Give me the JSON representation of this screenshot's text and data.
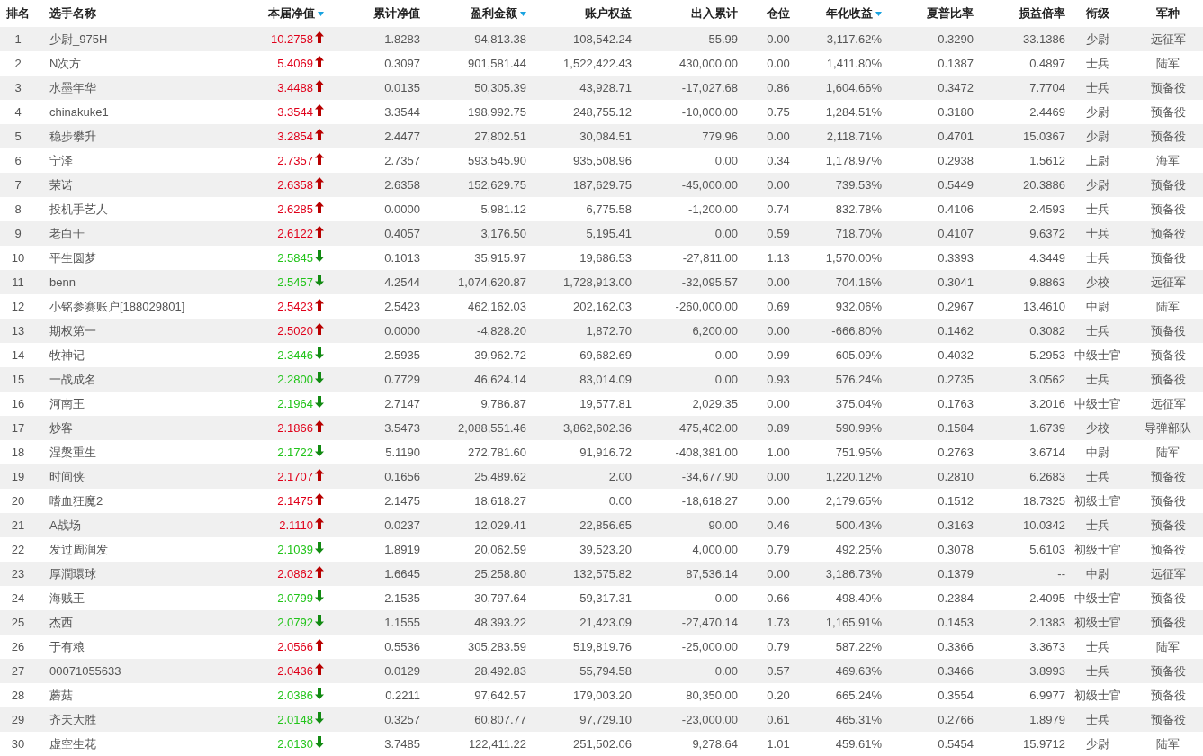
{
  "table": {
    "columns": [
      {
        "label": "排名",
        "sort_indicator": false
      },
      {
        "label": "选手名称",
        "sort_indicator": false
      },
      {
        "label": "本届净值",
        "sort_indicator": true
      },
      {
        "label": "累计净值",
        "sort_indicator": false
      },
      {
        "label": "盈利金额",
        "sort_indicator": true
      },
      {
        "label": "账户权益",
        "sort_indicator": false
      },
      {
        "label": "出入累计",
        "sort_indicator": false
      },
      {
        "label": "仓位",
        "sort_indicator": false
      },
      {
        "label": "年化收益",
        "sort_indicator": true
      },
      {
        "label": "夏普比率",
        "sort_indicator": false
      },
      {
        "label": "损益倍率",
        "sort_indicator": false
      },
      {
        "label": "衔级",
        "sort_indicator": false
      },
      {
        "label": "军种",
        "sort_indicator": false
      }
    ],
    "rows": [
      {
        "rising": true,
        "cells": [
          "1",
          "少尉_975H",
          "10.2758",
          "1.8283",
          "94,813.38",
          "108,542.24",
          "55.99",
          "0.00",
          "3,117.62%",
          "0.3290",
          "33.1386",
          "少尉",
          "远征军"
        ]
      },
      {
        "rising": true,
        "cells": [
          "2",
          "N次方",
          "5.4069",
          "0.3097",
          "901,581.44",
          "1,522,422.43",
          "430,000.00",
          "0.00",
          "1,411.80%",
          "0.1387",
          "0.4897",
          "士兵",
          "陆军"
        ]
      },
      {
        "rising": true,
        "cells": [
          "3",
          "水墨年华",
          "3.4488",
          "0.0135",
          "50,305.39",
          "43,928.71",
          "-17,027.68",
          "0.86",
          "1,604.66%",
          "0.3472",
          "7.7704",
          "士兵",
          "预备役"
        ]
      },
      {
        "rising": true,
        "cells": [
          "4",
          "chinakuke1",
          "3.3544",
          "3.3544",
          "198,992.75",
          "248,755.12",
          "-10,000.00",
          "0.75",
          "1,284.51%",
          "0.3180",
          "2.4469",
          "少尉",
          "预备役"
        ]
      },
      {
        "rising": true,
        "cells": [
          "5",
          "稳步攀升",
          "3.2854",
          "2.4477",
          "27,802.51",
          "30,084.51",
          "779.96",
          "0.00",
          "2,118.71%",
          "0.4701",
          "15.0367",
          "少尉",
          "预备役"
        ]
      },
      {
        "rising": true,
        "cells": [
          "6",
          "宁泽",
          "2.7357",
          "2.7357",
          "593,545.90",
          "935,508.96",
          "0.00",
          "0.34",
          "1,178.97%",
          "0.2938",
          "1.5612",
          "上尉",
          "海军"
        ]
      },
      {
        "rising": true,
        "cells": [
          "7",
          "荣诺",
          "2.6358",
          "2.6358",
          "152,629.75",
          "187,629.75",
          "-45,000.00",
          "0.00",
          "739.53%",
          "0.5449",
          "20.3886",
          "少尉",
          "预备役"
        ]
      },
      {
        "rising": true,
        "cells": [
          "8",
          "投机手艺人",
          "2.6285",
          "0.0000",
          "5,981.12",
          "6,775.58",
          "-1,200.00",
          "0.74",
          "832.78%",
          "0.4106",
          "2.4593",
          "士兵",
          "预备役"
        ]
      },
      {
        "rising": true,
        "cells": [
          "9",
          "老白干",
          "2.6122",
          "0.4057",
          "3,176.50",
          "5,195.41",
          "0.00",
          "0.59",
          "718.70%",
          "0.4107",
          "9.6372",
          "士兵",
          "预备役"
        ]
      },
      {
        "rising": false,
        "cells": [
          "10",
          "平生圆梦",
          "2.5845",
          "0.1013",
          "35,915.97",
          "19,686.53",
          "-27,811.00",
          "1.13",
          "1,570.00%",
          "0.3393",
          "4.3449",
          "士兵",
          "预备役"
        ]
      },
      {
        "rising": false,
        "cells": [
          "11",
          "benn",
          "2.5457",
          "4.2544",
          "1,074,620.87",
          "1,728,913.00",
          "-32,095.57",
          "0.00",
          "704.16%",
          "0.3041",
          "9.8863",
          "少校",
          "远征军"
        ]
      },
      {
        "rising": true,
        "cells": [
          "12",
          "小铭参赛账户[188029801]",
          "2.5423",
          "2.5423",
          "462,162.03",
          "202,162.03",
          "-260,000.00",
          "0.69",
          "932.06%",
          "0.2967",
          "13.4610",
          "中尉",
          "陆军"
        ]
      },
      {
        "rising": true,
        "cells": [
          "13",
          "期权第一",
          "2.5020",
          "0.0000",
          "-4,828.20",
          "1,872.70",
          "6,200.00",
          "0.00",
          "-666.80%",
          "0.1462",
          "0.3082",
          "士兵",
          "预备役"
        ]
      },
      {
        "rising": false,
        "cells": [
          "14",
          "牧神记",
          "2.3446",
          "2.5935",
          "39,962.72",
          "69,682.69",
          "0.00",
          "0.99",
          "605.09%",
          "0.4032",
          "5.2953",
          "中级士官",
          "预备役"
        ]
      },
      {
        "rising": false,
        "cells": [
          "15",
          "一战成名",
          "2.2800",
          "0.7729",
          "46,624.14",
          "83,014.09",
          "0.00",
          "0.93",
          "576.24%",
          "0.2735",
          "3.0562",
          "士兵",
          "预备役"
        ]
      },
      {
        "rising": false,
        "cells": [
          "16",
          "河南王",
          "2.1964",
          "2.7147",
          "9,786.87",
          "19,577.81",
          "2,029.35",
          "0.00",
          "375.04%",
          "0.1763",
          "3.2016",
          "中级士官",
          "远征军"
        ]
      },
      {
        "rising": true,
        "cells": [
          "17",
          "炒客",
          "2.1866",
          "3.5473",
          "2,088,551.46",
          "3,862,602.36",
          "475,402.00",
          "0.89",
          "590.99%",
          "0.1584",
          "1.6739",
          "少校",
          "导弹部队"
        ]
      },
      {
        "rising": false,
        "cells": [
          "18",
          "涅槃重生",
          "2.1722",
          "5.1190",
          "272,781.60",
          "91,916.72",
          "-408,381.00",
          "1.00",
          "751.95%",
          "0.2763",
          "3.6714",
          "中尉",
          "陆军"
        ]
      },
      {
        "rising": true,
        "cells": [
          "19",
          "时间侠",
          "2.1707",
          "0.1656",
          "25,489.62",
          "2.00",
          "-34,677.90",
          "0.00",
          "1,220.12%",
          "0.2810",
          "6.2683",
          "士兵",
          "预备役"
        ]
      },
      {
        "rising": true,
        "cells": [
          "20",
          "嗜血狂魔2",
          "2.1475",
          "2.1475",
          "18,618.27",
          "0.00",
          "-18,618.27",
          "0.00",
          "2,179.65%",
          "0.1512",
          "18.7325",
          "初级士官",
          "预备役"
        ]
      },
      {
        "rising": true,
        "cells": [
          "21",
          "A战场",
          "2.1110",
          "0.0237",
          "12,029.41",
          "22,856.65",
          "90.00",
          "0.46",
          "500.43%",
          "0.3163",
          "10.0342",
          "士兵",
          "预备役"
        ]
      },
      {
        "rising": false,
        "cells": [
          "22",
          "发过周润发",
          "2.1039",
          "1.8919",
          "20,062.59",
          "39,523.20",
          "4,000.00",
          "0.79",
          "492.25%",
          "0.3078",
          "5.6103",
          "初级士官",
          "预备役"
        ]
      },
      {
        "rising": true,
        "cells": [
          "23",
          "厚潤環球",
          "2.0862",
          "1.6645",
          "25,258.80",
          "132,575.82",
          "87,536.14",
          "0.00",
          "3,186.73%",
          "0.1379",
          "--",
          "中尉",
          "远征军"
        ]
      },
      {
        "rising": false,
        "cells": [
          "24",
          "海贼王",
          "2.0799",
          "2.1535",
          "30,797.64",
          "59,317.31",
          "0.00",
          "0.66",
          "498.40%",
          "0.2384",
          "2.4095",
          "中级士官",
          "预备役"
        ]
      },
      {
        "rising": false,
        "cells": [
          "25",
          "杰西",
          "2.0792",
          "1.1555",
          "48,393.22",
          "21,423.09",
          "-27,470.14",
          "1.73",
          "1,165.91%",
          "0.1453",
          "2.1383",
          "初级士官",
          "预备役"
        ]
      },
      {
        "rising": true,
        "cells": [
          "26",
          "于有粮",
          "2.0566",
          "0.5536",
          "305,283.59",
          "519,819.76",
          "-25,000.00",
          "0.79",
          "587.22%",
          "0.3366",
          "3.3673",
          "士兵",
          "陆军"
        ]
      },
      {
        "rising": true,
        "cells": [
          "27",
          "00071055633",
          "2.0436",
          "0.0129",
          "28,492.83",
          "55,794.58",
          "0.00",
          "0.57",
          "469.63%",
          "0.3466",
          "3.8993",
          "士兵",
          "预备役"
        ]
      },
      {
        "rising": false,
        "cells": [
          "28",
          "蘑菇",
          "2.0386",
          "0.2211",
          "97,642.57",
          "179,003.20",
          "80,350.00",
          "0.20",
          "665.24%",
          "0.3554",
          "6.9977",
          "初级士官",
          "预备役"
        ]
      },
      {
        "rising": false,
        "cells": [
          "29",
          "齐天大胜",
          "2.0148",
          "0.3257",
          "60,807.77",
          "97,729.10",
          "-23,000.00",
          "0.61",
          "465.31%",
          "0.2766",
          "1.8979",
          "士兵",
          "预备役"
        ]
      },
      {
        "rising": false,
        "cells": [
          "30",
          "虚空生花",
          "2.0130",
          "3.7485",
          "122,411.22",
          "251,502.06",
          "9,278.64",
          "1.01",
          "459.61%",
          "0.5454",
          "15.9712",
          "少尉",
          "陆军"
        ]
      }
    ]
  }
}
